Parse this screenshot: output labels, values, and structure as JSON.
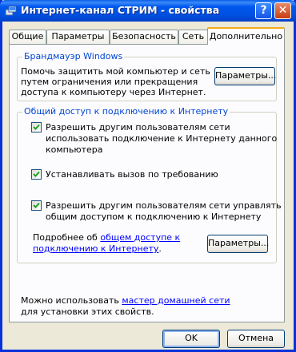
{
  "window": {
    "title": "Интернет-канал СТРИМ - свойства",
    "help_label": "?",
    "close_label": "✕"
  },
  "tabs": [
    {
      "label": "Общие"
    },
    {
      "label": "Параметры"
    },
    {
      "label": "Безопасность"
    },
    {
      "label": "Сеть"
    },
    {
      "label": "Дополнительно",
      "active": true
    }
  ],
  "firewall": {
    "legend": "Брандмауэр Windows",
    "description_lines": [
      "Помочь защитить мой компьютер и сеть",
      "путем ограничения или прекращения",
      "доступа к компьютеру через Интернет."
    ],
    "settings_button": "Параметры..."
  },
  "ics": {
    "legend": "Общий доступ к подключению к Интернету",
    "options": [
      {
        "checked": true,
        "lines": [
          "Разрешить другим пользователям сети",
          "использовать подключение к Интернету данного",
          "компьютера"
        ]
      },
      {
        "checked": true,
        "lines": [
          "Устанавливать вызов по требованию"
        ]
      },
      {
        "checked": true,
        "lines": [
          "Разрешить другим пользователям сети управлять",
          "общим доступом к подключению к Интернету"
        ]
      }
    ],
    "more_prefix": "Подробнее об ",
    "more_link_1": "общем доступе к",
    "more_link_2": "подключению к Интернету",
    "more_suffix": ".",
    "settings_button": "Параметры..."
  },
  "wizard": {
    "prefix": "Можно использовать ",
    "link": "мастер домашней сети",
    "line2": "для установки этих свойств."
  },
  "buttons": {
    "ok": "OK",
    "cancel": "Отмена"
  },
  "colors": {
    "titlebar": "#0058ee",
    "legend": "#0046d5",
    "link": "#0000ff",
    "active_tab_accent": "#f4a91c"
  }
}
